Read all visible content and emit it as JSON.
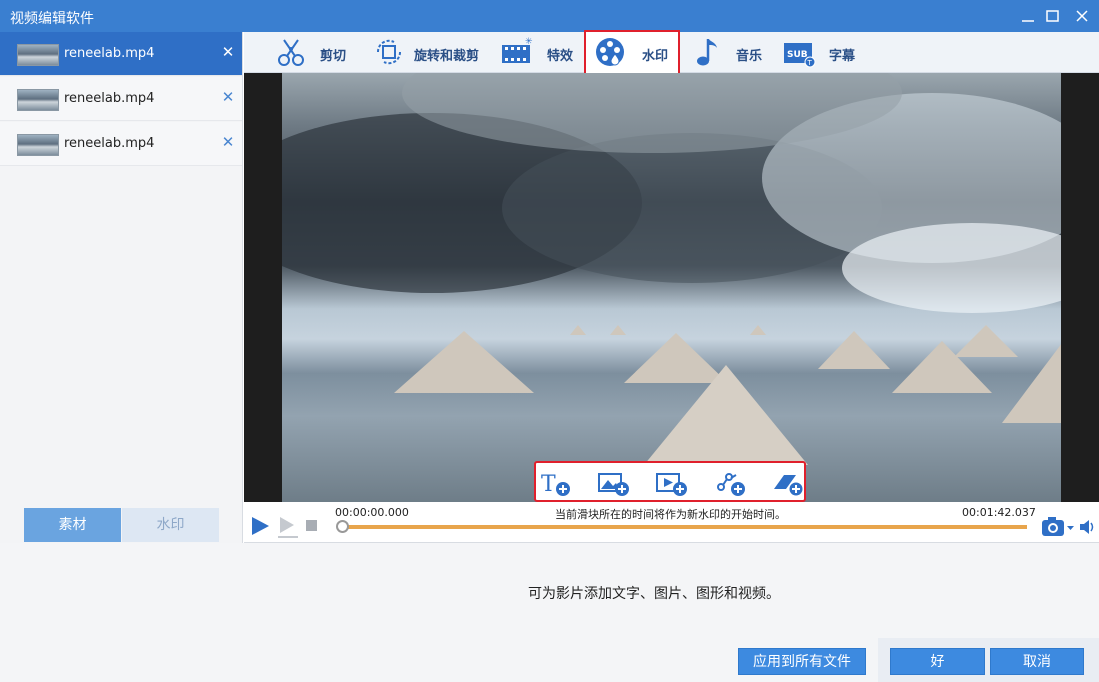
{
  "window": {
    "title": "视频编辑软件"
  },
  "files": [
    {
      "name": "reneelab.mp4",
      "close": "✕"
    },
    {
      "name": "reneelab.mp4",
      "close": "✕"
    },
    {
      "name": "reneelab.mp4",
      "close": "✕"
    }
  ],
  "left_tabs": {
    "material": "素材",
    "watermark": "水印"
  },
  "toolbar": {
    "cut": "剪切",
    "rotate_crop": "旋转和裁剪",
    "effects": "特效",
    "watermark": "水印",
    "music": "音乐",
    "subtitle": "字幕"
  },
  "timeline": {
    "start_time": "00:00:00.000",
    "end_time": "00:01:42.037",
    "hint": "当前滑块所在的时间将作为新水印的开始时间。",
    "progress": 0
  },
  "description": "可为影片添加文字、图片、图形和视频。",
  "buttons": {
    "apply_all": "应用到所有文件",
    "ok": "好",
    "cancel": "取消"
  },
  "colors": {
    "accent": "#3a7fd0",
    "highlight": "#e0202c",
    "progress": "#e8750c"
  }
}
